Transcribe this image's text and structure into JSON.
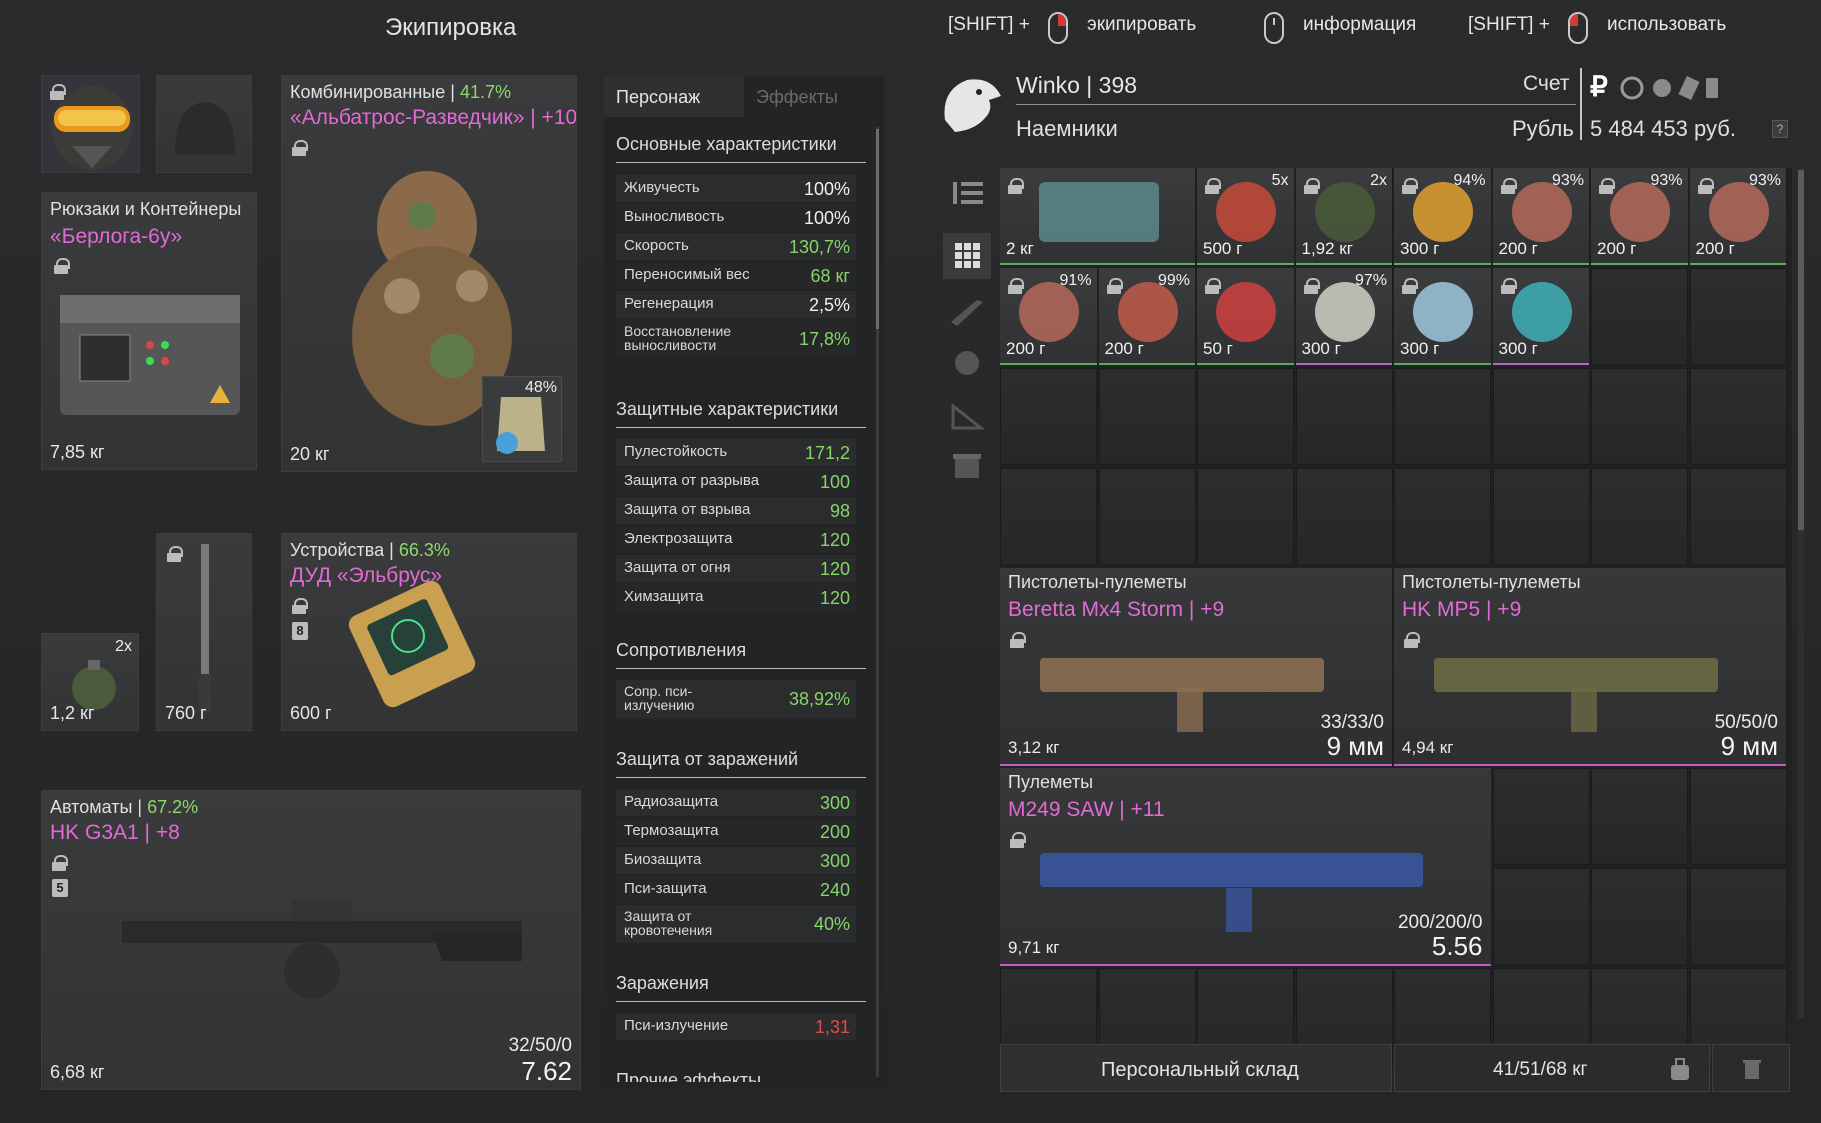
{
  "left_title": "Экипировка",
  "hints": [
    {
      "prefix": "[SHIFT] +",
      "label": "экипировать"
    },
    {
      "prefix": "",
      "label": "информация"
    },
    {
      "prefix": "[SHIFT] +",
      "label": "использовать"
    }
  ],
  "equipment": {
    "armor": {
      "category": "Комбинированные",
      "percent": "41.7%",
      "name": "«Альбатрос-Разведчик» | +10",
      "weight": "20 кг",
      "container_pct": "48%"
    },
    "backpack": {
      "category": "Рюкзаки и Контейнеры",
      "name": "«Берлога-6у»",
      "weight": "7,85 кг"
    },
    "device": {
      "category": "Устройства",
      "percent": "66.3%",
      "name": "ДУД «Эльбрус»",
      "weight": "600 г",
      "badge": "8"
    },
    "grenade": {
      "count": "2x",
      "weight": "1,2 кг"
    },
    "melee": {
      "weight": "760 г"
    },
    "primary": {
      "category": "Автоматы",
      "percent": "67.2%",
      "name": "HK G3A1 | +8",
      "weight": "6,68 кг",
      "badge": "5",
      "ammo": "32/50/0",
      "caliber": "7.62"
    }
  },
  "stats": {
    "tabs": [
      "Персонаж",
      "Эффекты"
    ],
    "sections": [
      {
        "title": "Основные характеристики",
        "rows": [
          {
            "label": "Живучесть",
            "value": "100%",
            "color": "white"
          },
          {
            "label": "Выносливость",
            "value": "100%",
            "color": "white"
          },
          {
            "label": "Скорость",
            "value": "130,7%",
            "color": "green"
          },
          {
            "label": "Переносимый вес",
            "value": "68 кг",
            "color": "green"
          },
          {
            "label": "Регенерация",
            "value": "2,5%",
            "color": "white"
          },
          {
            "label": "Восстановление выносливости",
            "value": "17,8%",
            "color": "green"
          }
        ]
      },
      {
        "title": "Защитные характеристики",
        "rows": [
          {
            "label": "Пулестойкость",
            "value": "171,2",
            "color": "green"
          },
          {
            "label": "Защита от разрыва",
            "value": "100",
            "color": "green"
          },
          {
            "label": "Защита от взрыва",
            "value": "98",
            "color": "green"
          },
          {
            "label": "Электрозащита",
            "value": "120",
            "color": "green"
          },
          {
            "label": "Защита от огня",
            "value": "120",
            "color": "green"
          },
          {
            "label": "Химзащита",
            "value": "120",
            "color": "green"
          }
        ]
      },
      {
        "title": "Сопротивления",
        "rows": [
          {
            "label": "Сопр. пси-излучению",
            "value": "38,92%",
            "color": "green"
          }
        ]
      },
      {
        "title": "Защита от заражений",
        "rows": [
          {
            "label": "Радиозащита",
            "value": "300",
            "color": "green"
          },
          {
            "label": "Термозащита",
            "value": "200",
            "color": "green"
          },
          {
            "label": "Биозащита",
            "value": "300",
            "color": "green"
          },
          {
            "label": "Пси-защита",
            "value": "240",
            "color": "green"
          },
          {
            "label": "Защита от кровотечения",
            "value": "40%",
            "color": "green"
          }
        ]
      },
      {
        "title": "Заражения",
        "rows": [
          {
            "label": "Пси-излучение",
            "value": "1,31",
            "color": "red"
          }
        ]
      }
    ],
    "cut_off_title": "Прочие эффекты"
  },
  "player": {
    "name": "Winko | 398",
    "faction": "Наемники",
    "account_label": "Счет",
    "currency_label": "Рубль",
    "balance": "5 484 453 руб.",
    "help": "?"
  },
  "inventory": {
    "items": [
      {
        "weight": "2 кг",
        "top": "",
        "border": "green"
      },
      {
        "weight": "500 г",
        "top": "5x",
        "border": "green"
      },
      {
        "weight": "1,92 кг",
        "top": "2x",
        "border": "green"
      },
      {
        "weight": "300 г",
        "top": "94%",
        "border": "green"
      },
      {
        "weight": "200 г",
        "top": "93%",
        "border": "green"
      },
      {
        "weight": "200 г",
        "top": "93%",
        "border": "green"
      },
      {
        "weight": "200 г",
        "top": "93%",
        "border": "green"
      },
      {
        "weight": "200 г",
        "top": "91%",
        "border": "green"
      },
      {
        "weight": "200 г",
        "top": "99%",
        "border": "green"
      },
      {
        "weight": "50 г",
        "top": "",
        "border": "green"
      },
      {
        "weight": "300 г",
        "top": "97%",
        "border": "purple"
      },
      {
        "weight": "300 г",
        "top": "",
        "border": "green"
      },
      {
        "weight": "300 г",
        "top": "",
        "border": "purple"
      }
    ],
    "weapons": [
      {
        "category": "Пистолеты-пулеметы",
        "name": "Beretta Mx4 Storm | +9",
        "weight": "3,12 кг",
        "ammo": "33/33/0",
        "caliber": "9 мм"
      },
      {
        "category": "Пистолеты-пулеметы",
        "name": "HK MP5 | +9",
        "weight": "4,94 кг",
        "ammo": "50/50/0",
        "caliber": "9 мм"
      },
      {
        "category": "Пулеметы",
        "name": "M249 SAW | +11",
        "weight": "9,71 кг",
        "ammo": "200/200/0",
        "caliber": "5.56"
      }
    ]
  },
  "footer": {
    "storage_label": "Персональный склад",
    "weight_info": "41/51/68 кг"
  }
}
